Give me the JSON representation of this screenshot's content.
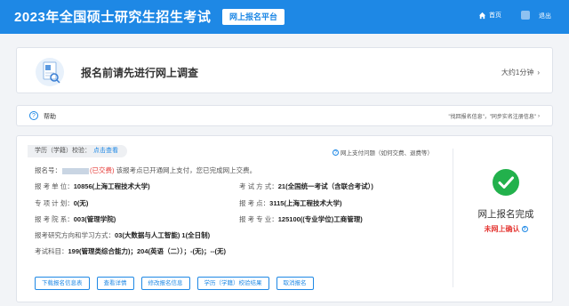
{
  "header": {
    "title": "2023年全国硕士研究生招生考试",
    "platform": "网上报名平台",
    "home": "首页",
    "logout": "退出"
  },
  "survey": {
    "text": "报名前请先进行网上调查",
    "duration": "大约1分钟"
  },
  "help": {
    "label": "帮助",
    "links": "\"找回报名信息\"，\"同步实名注册信息\""
  },
  "main": {
    "verify": {
      "label": "学历（学籍）校验：",
      "link": "点击查看"
    },
    "pay_question": "网上支付问题（如何交费、退费等）",
    "reg_no": {
      "label": "报名号：",
      "paid": "(已交费)",
      "note": "该报考点已开通网上支付，您已完成网上交费。"
    },
    "fields": {
      "unit_k": "报 考 单 位：",
      "unit_v": "10856(上海工程技术大学)",
      "mode_k": "考 试 方 式：",
      "mode_v": "21(全国统一考试（含联合考试）)",
      "plan_k": "专 项 计 划：",
      "plan_v": "0(无)",
      "site_k": "报 考 点：",
      "site_v": "3115(上海工程技术大学)",
      "dept_k": "报 考 院 系：",
      "dept_v": "003(管理学院)",
      "major_k": "报 考 专 业：",
      "major_v": "125100((专业学位)工商管理)",
      "dir_k": "报考研究方向和学习方式：",
      "dir_v": "03(大数据与人工智能) 1(全日制)",
      "subj_k": "考试科目：",
      "subj_v": "199(管理类综合能力)；204(英语（二））；-(无)；--(无)"
    },
    "status": {
      "complete": "网上报名完成",
      "unconfirmed": "未网上确认"
    },
    "buttons": [
      "下载报名信息表",
      "查看详情",
      "修改报名信息",
      "学历（学籍）校验结果",
      "取消报名"
    ]
  },
  "colors": {
    "brand": "#1e88e5",
    "success": "#22b14c",
    "warning": "#e53935"
  }
}
